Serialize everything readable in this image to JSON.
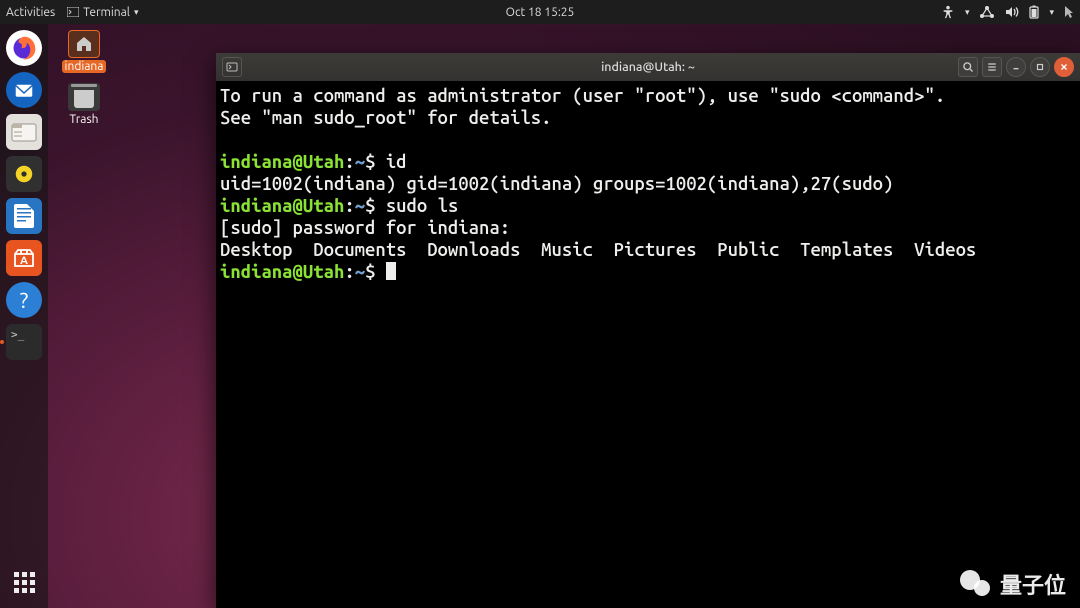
{
  "topbar": {
    "activities": "Activities",
    "app_menu": "Terminal",
    "clock": "Oct 18  15:25"
  },
  "desktop": {
    "home_label": "indiana",
    "trash_label": "Trash"
  },
  "dock": {
    "firefox": "Firefox",
    "thunderbird": "Thunderbird",
    "files": "Files",
    "rhythmbox": "Rhythmbox",
    "writer": "LibreOffice Writer",
    "software": "Ubuntu Software",
    "help": "Help",
    "terminal": "Terminal",
    "show_apps": "Show Applications"
  },
  "window": {
    "title": "indiana@Utah: ~",
    "lines": {
      "l1": "To run a command as administrator (user \"root\"), use \"sudo <command>\".",
      "l2": "See \"man sudo_root\" for details.",
      "blank1": "",
      "p1_userhost": "indiana@Utah",
      "p1_colon": ":",
      "p1_path": "~",
      "p1_dollar": "$ ",
      "p1_cmd": "id",
      "l4": "uid=1002(indiana) gid=1002(indiana) groups=1002(indiana),27(sudo)",
      "p2_cmd": "sudo ls",
      "l6": "[sudo] password for indiana:",
      "l7": "Desktop  Documents  Downloads  Music  Pictures  Public  Templates  Videos",
      "p3_cmd": ""
    }
  },
  "watermark": "量子位"
}
